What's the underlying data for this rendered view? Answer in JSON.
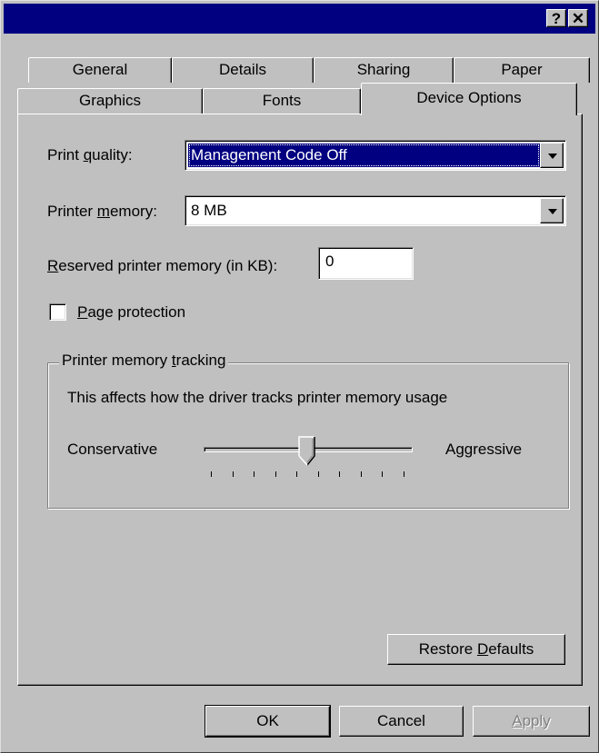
{
  "titlebar": {
    "help_label": "?",
    "close_label": "✕"
  },
  "tabs": {
    "back_row": [
      "General",
      "Details",
      "Sharing",
      "Paper"
    ],
    "front_row": [
      "Graphics",
      "Fonts",
      "Device Options"
    ],
    "active": "Device Options"
  },
  "device_options": {
    "print_quality": {
      "label_pre": "Print ",
      "label_key": "q",
      "label_post": "uality:",
      "value": "Management Code  Off"
    },
    "printer_memory": {
      "label_pre": "Printer ",
      "label_key": "m",
      "label_post": "emory:",
      "value": "8 MB"
    },
    "reserved_memory": {
      "label_key": "R",
      "label_post": "eserved printer memory (in KB):",
      "value": "0"
    },
    "page_protection": {
      "label_key": "P",
      "label_post": "age protection",
      "checked": false
    },
    "tracking": {
      "group_pre": "Printer memory ",
      "group_key": "t",
      "group_post": "racking",
      "description": "This affects how the driver tracks printer memory usage",
      "min_label": "Conservative",
      "max_label": "Aggressive",
      "tick_count": 10,
      "position": 0.5
    },
    "restore_defaults": {
      "label_pre": "Restore ",
      "label_key": "D",
      "label_post": "efaults"
    }
  },
  "footer": {
    "ok_label": "OK",
    "cancel_label": "Cancel",
    "apply_label": "Apply",
    "apply_key": "A",
    "apply_rest": "pply"
  }
}
